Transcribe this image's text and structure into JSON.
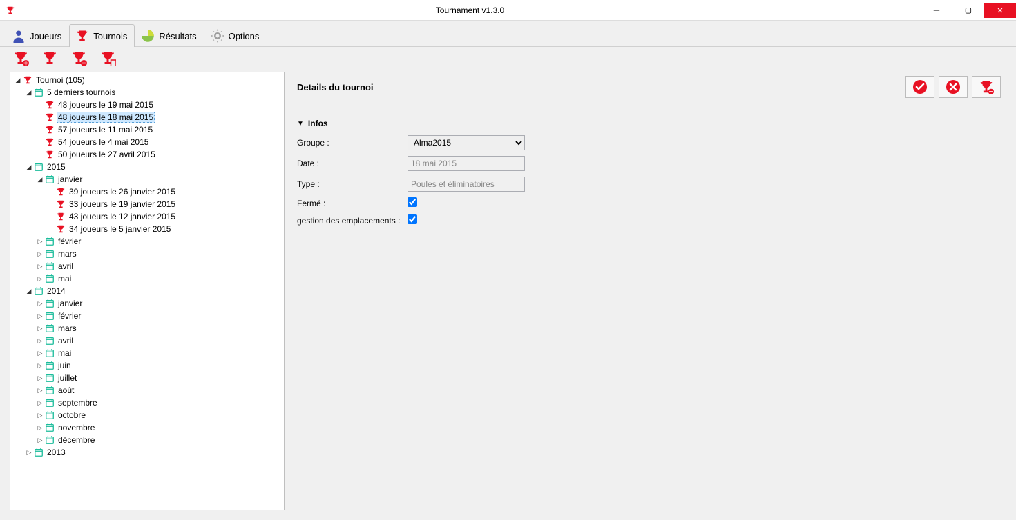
{
  "window": {
    "title": "Tournament v1.3.0"
  },
  "tabs": {
    "joueurs": "Joueurs",
    "tournois": "Tournois",
    "resultats": "Résultats",
    "options": "Options"
  },
  "tree": {
    "root": "Tournoi (105)",
    "recent": {
      "label": "5 derniers tournois",
      "items": [
        "48 joueurs le 19 mai 2015",
        "48 joueurs le 18 mai 2015",
        "57 joueurs le 11 mai 2015",
        "54 joueurs le 4 mai 2015",
        "50 joueurs le 27 avril 2015"
      ]
    },
    "y2015": {
      "label": "2015",
      "janvier": {
        "label": "janvier",
        "items": [
          "39 joueurs le 26 janvier 2015",
          "33 joueurs le 19 janvier 2015",
          "43 joueurs le 12 janvier 2015",
          "34 joueurs le 5 janvier 2015"
        ]
      },
      "months": [
        "février",
        "mars",
        "avril",
        "mai"
      ]
    },
    "y2014": {
      "label": "2014",
      "months": [
        "janvier",
        "février",
        "mars",
        "avril",
        "mai",
        "juin",
        "juillet",
        "août",
        "septembre",
        "octobre",
        "novembre",
        "décembre"
      ]
    },
    "y2013": {
      "label": "2013"
    }
  },
  "details": {
    "title": "Details du tournoi",
    "section": "Infos",
    "fields": {
      "groupe_label": "Groupe :",
      "groupe_value": "Alma2015",
      "date_label": "Date :",
      "date_value": "18 mai 2015",
      "type_label": "Type :",
      "type_value": "Poules et éliminatoires",
      "ferme_label": "Fermé :",
      "emplacements_label": "gestion des emplacements :"
    }
  }
}
